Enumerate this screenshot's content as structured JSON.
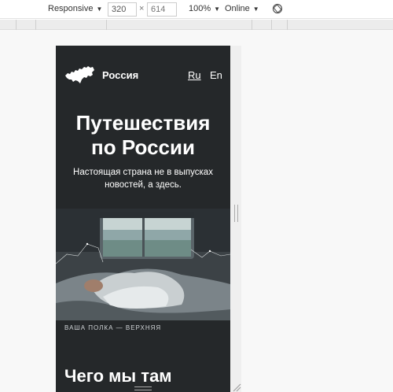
{
  "devtools": {
    "device_label": "Responsive",
    "width_value": "320",
    "times": "×",
    "height_placeholder": "614",
    "zoom_label": "100%",
    "network_label": "Online",
    "caret": "▼",
    "rotate_icon": "rotate-icon"
  },
  "site": {
    "logo_icon": "russia-map-logo",
    "logo_text": "Россия",
    "languages": [
      {
        "label": "Ru",
        "active": true
      },
      {
        "label": "En",
        "active": false
      }
    ],
    "hero": {
      "title_line1": "Путешествия",
      "title_line2": "по России",
      "subtitle_line1": "Настоящая страна не в выпусках",
      "subtitle_line2": "новостей, а здесь."
    },
    "photo_caption": "ВАША ПОЛКА — ВЕРХНЯЯ",
    "section_title": "Чего мы там"
  },
  "colors": {
    "page_background": "#25282a",
    "text": "#ffffff"
  }
}
